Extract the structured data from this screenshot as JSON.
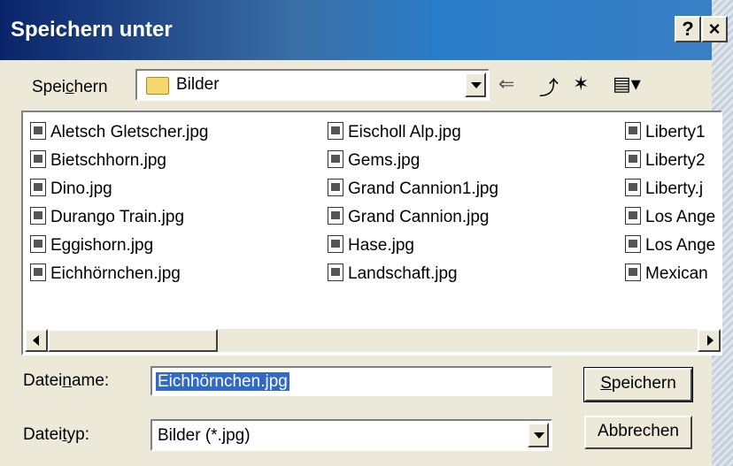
{
  "window": {
    "title": "Speichern unter",
    "help_label": "?",
    "close_label": "×"
  },
  "location": {
    "label_pre": "Spei",
    "label_access": "c",
    "label_post": "hern",
    "value": "Bilder"
  },
  "files": [
    "Aletsch Gletscher.jpg",
    "Bietschhorn.jpg",
    "Dino.jpg",
    "Durango Train.jpg",
    "Eggishorn.jpg",
    "Eichhörnchen.jpg",
    "Eischoll Alp.jpg",
    "Gems.jpg",
    "Grand Cannion1.jpg",
    "Grand Cannion.jpg",
    "Hase.jpg",
    "Landschaft.jpg",
    "Liberty1",
    "Liberty2",
    "Liberty.j",
    "Los Ange",
    "Los Ange",
    "Mexican"
  ],
  "filename": {
    "label_pre": "Datei",
    "label_access": "n",
    "label_post": "ame:",
    "value": "Eichhörnchen.jpg"
  },
  "filetype": {
    "label_pre": "Datei",
    "label_access": "t",
    "label_post": "yp:",
    "value": "Bilder (*.jpg)"
  },
  "buttons": {
    "save_access": "S",
    "save_rest": "peichern",
    "cancel": "Abbrechen"
  }
}
